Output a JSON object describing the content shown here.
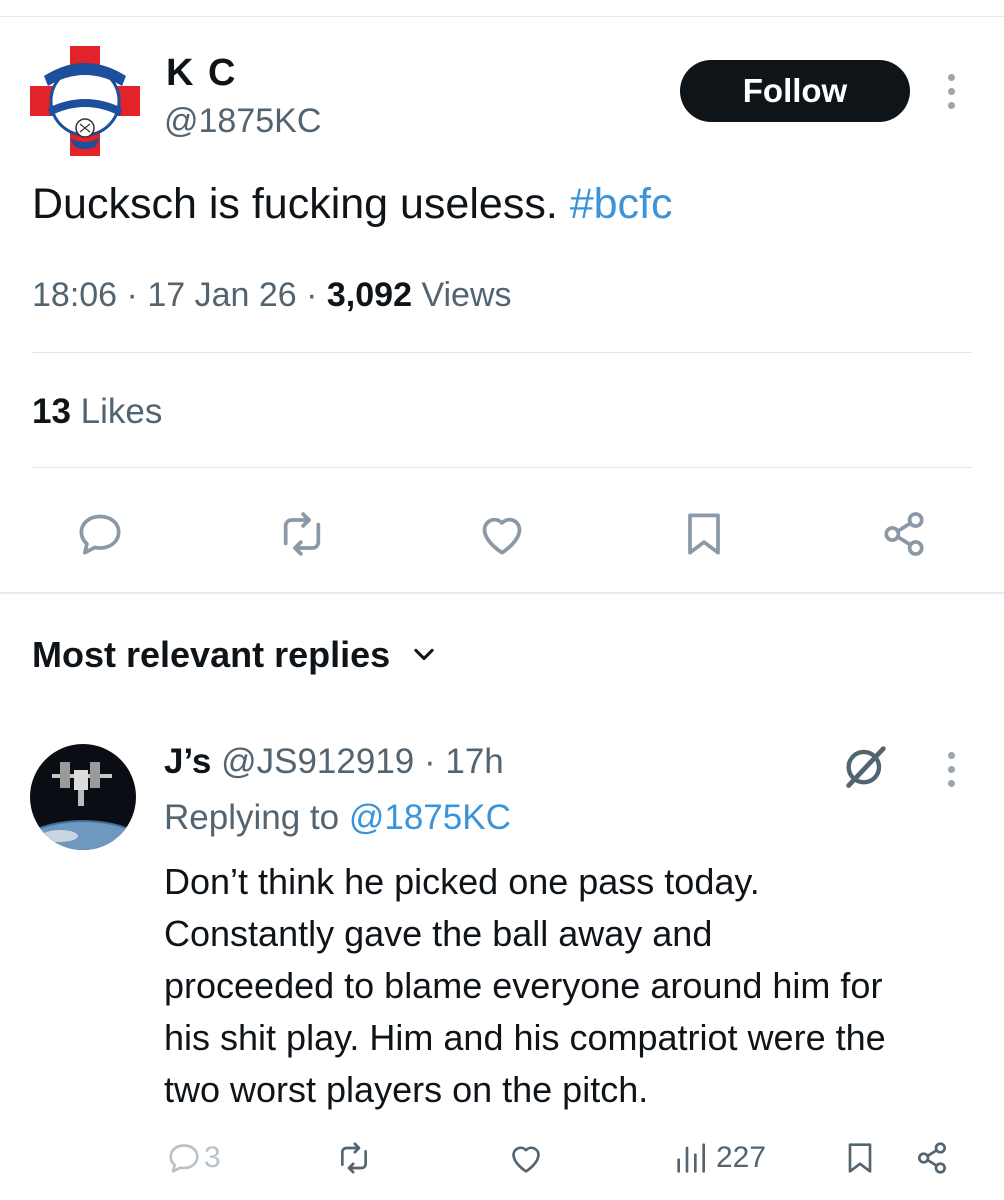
{
  "tweet": {
    "author_name": "K C",
    "author_handle": "@1875KC",
    "follow_label": "Follow",
    "text": "Ducksch is fucking useless. ",
    "hashtag": "#bcfc",
    "time": "18:06",
    "date": "17 Jan 26",
    "views_count": "3,092",
    "views_label": "Views",
    "likes_count": "13",
    "likes_label": "Likes",
    "avatar_icon": "birmingham-city-crest"
  },
  "replies_sort": {
    "label": "Most relevant replies"
  },
  "reply": {
    "author_name": "J’s",
    "author_handle": "@JS912919",
    "age": "17h",
    "replying_label": "Replying to",
    "replying_to": "@1875KC",
    "body_lines": [
      "Don’t think he picked one pass today.",
      "Constantly gave the ball away and",
      "proceeded to blame everyone around him for",
      "his shit play. Him and his compatriot were the",
      "two worst players on the pitch."
    ],
    "reply_count": "3",
    "views_count": "227"
  },
  "colors": {
    "link": "#3b94d9",
    "text": "#0f1419",
    "muted": "#536471",
    "icon": "#8b98a5",
    "button": "#0f1419"
  }
}
